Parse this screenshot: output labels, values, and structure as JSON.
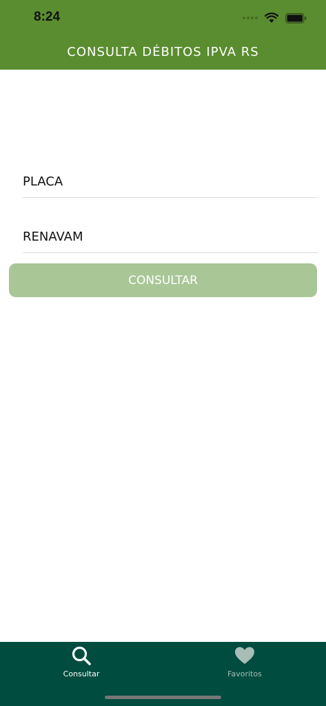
{
  "status_bar": {
    "time": "8:24",
    "icons": [
      "signal-icon",
      "wifi-icon",
      "battery-icon"
    ]
  },
  "header": {
    "title": "CONSULTA DÉBITOS IPVA RS"
  },
  "form": {
    "plate_placeholder": "PLACA",
    "renavam_placeholder": "RENAVAM",
    "submit_label": "CONSULTAR"
  },
  "tab_bar": {
    "tabs": [
      {
        "label": "Consultar",
        "icon": "search-icon",
        "active": true
      },
      {
        "label": "Favoritos",
        "icon": "heart-icon",
        "active": false
      }
    ]
  },
  "colors": {
    "header_bg": "#5a8d2f",
    "button_bg": "#a9c697",
    "tabbar_bg": "#004c3f",
    "tab_inactive": "#a7bdb6"
  }
}
